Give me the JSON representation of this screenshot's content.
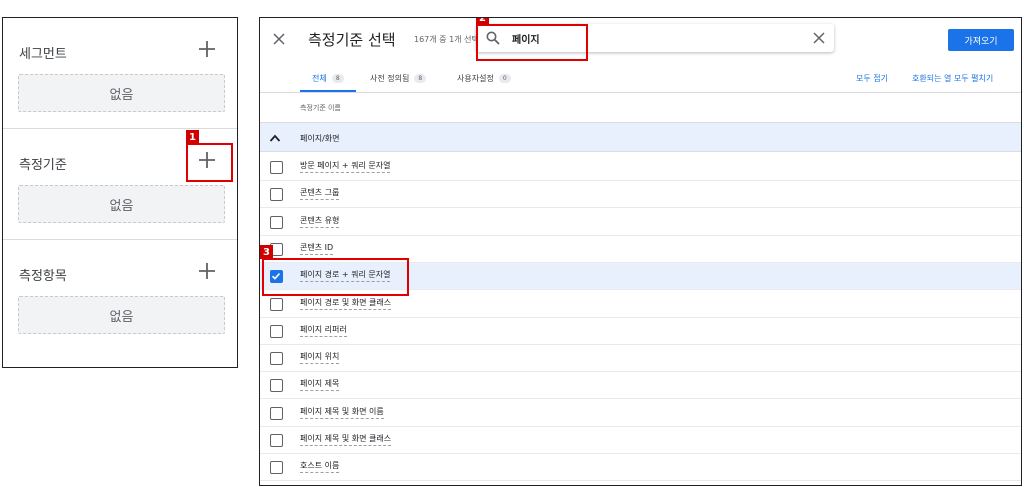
{
  "left_panel": {
    "sections": [
      {
        "title": "세그먼트",
        "empty_text": "없음"
      },
      {
        "title": "측정기준",
        "empty_text": "없음"
      },
      {
        "title": "측정항목",
        "empty_text": "없음"
      }
    ]
  },
  "dialog": {
    "title": "측정기준 선택",
    "count_text": "167개 중 1개 선택됨",
    "search": {
      "value": "페이지",
      "placeholder": ""
    },
    "import_label": "가져오기",
    "tabs": [
      {
        "label": "전체",
        "count": "8"
      },
      {
        "label": "사전 정의됨",
        "count": "8"
      },
      {
        "label": "사용자설정",
        "count": "0"
      }
    ],
    "collapse_all_label": "모두 접기",
    "expand_all_label": "호환되는 열 모두 펼치기",
    "column_header": "측정기준 이름",
    "group": {
      "label": "페이지/화면",
      "expanded": true
    },
    "items": [
      {
        "label": "방문 페이지 + 쿼리 문자열",
        "checked": false
      },
      {
        "label": "콘텐츠 그룹",
        "checked": false
      },
      {
        "label": "콘텐츠 유형",
        "checked": false
      },
      {
        "label": "콘텐츠 ID",
        "checked": false
      },
      {
        "label": "페이지 경로 + 쿼리 문자열",
        "checked": true
      },
      {
        "label": "페이지 경로 및 화면 클래스",
        "checked": false
      },
      {
        "label": "페이지 리퍼러",
        "checked": false
      },
      {
        "label": "페이지 위치",
        "checked": false
      },
      {
        "label": "페이지 제목",
        "checked": false
      },
      {
        "label": "페이지 제목 및 화면 이름",
        "checked": false
      },
      {
        "label": "페이지 제목 및 화면 클래스",
        "checked": false
      },
      {
        "label": "호스트 이름",
        "checked": false
      }
    ]
  },
  "annotations": [
    {
      "number": "1"
    },
    {
      "number": "2"
    },
    {
      "number": "3"
    }
  ],
  "colors": {
    "accent": "#1a73e8",
    "annotation": "#e00000",
    "selected_row": "#e8f0fe"
  }
}
